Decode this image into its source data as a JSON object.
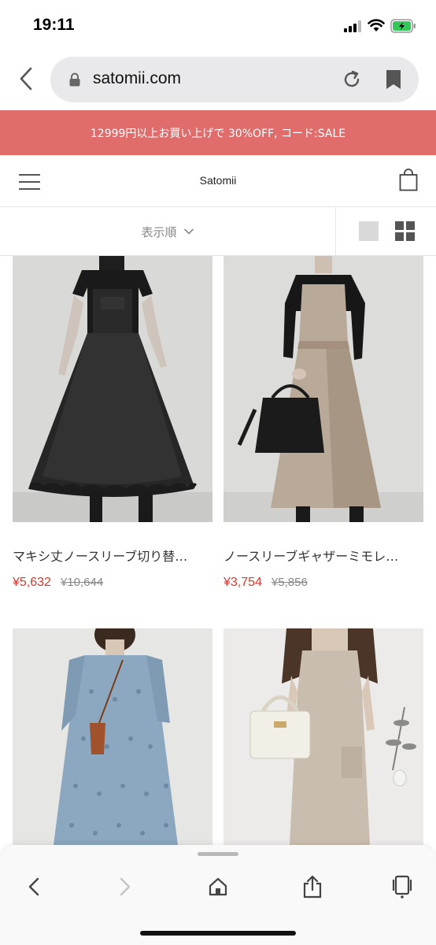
{
  "status_bar": {
    "time": "19:11"
  },
  "browser": {
    "url": "satomii.com"
  },
  "promo": {
    "text": "12999円以上お買い上げで 30%OFF, コード:SALE"
  },
  "header": {
    "title": "Satomii"
  },
  "sort": {
    "label": "表示順"
  },
  "products": [
    {
      "name": "マキシ丈ノースリーブ切り替…",
      "price": "¥5,632",
      "old_price": "¥10,644",
      "image": "black-tulle-overall-dress"
    },
    {
      "name": "ノースリーブギャザーミモレ…",
      "price": "¥3,754",
      "old_price": "¥5,856",
      "image": "beige-apron-dress"
    },
    {
      "image": "blue-eyelet-maxi-dress"
    },
    {
      "image": "beige-knit-dress"
    }
  ],
  "colors": {
    "accent": "#e06c6b",
    "price": "#e3332b"
  },
  "icons": [
    "back-icon",
    "lock-icon",
    "reload-icon",
    "bookmark-icon",
    "hamburger-icon",
    "shopping-bag-icon",
    "chevron-down-icon",
    "single-view-icon",
    "grid-view-icon",
    "forward-icon",
    "home-icon",
    "share-icon",
    "tabs-icon"
  ]
}
